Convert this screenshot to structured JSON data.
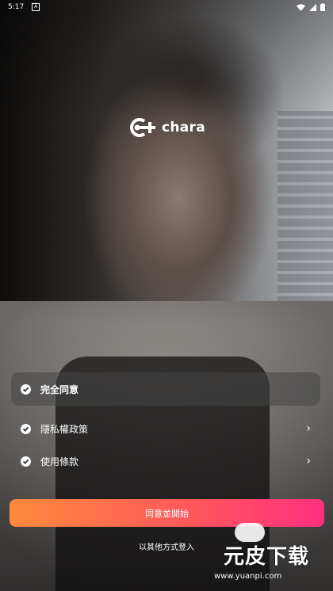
{
  "status_bar": {
    "time": "5:17",
    "app_icon": "A"
  },
  "brand": {
    "name": "chara"
  },
  "options": [
    {
      "label": "完全同意",
      "has_chevron": false
    },
    {
      "label": "隱私權政策",
      "has_chevron": true
    },
    {
      "label": "使用條款",
      "has_chevron": true
    }
  ],
  "cta": {
    "label": "同意並開始"
  },
  "other_login": {
    "label": "以其他方式登入"
  },
  "watermark": {
    "text": "元皮下载",
    "url": "www.yuanpi.com"
  }
}
